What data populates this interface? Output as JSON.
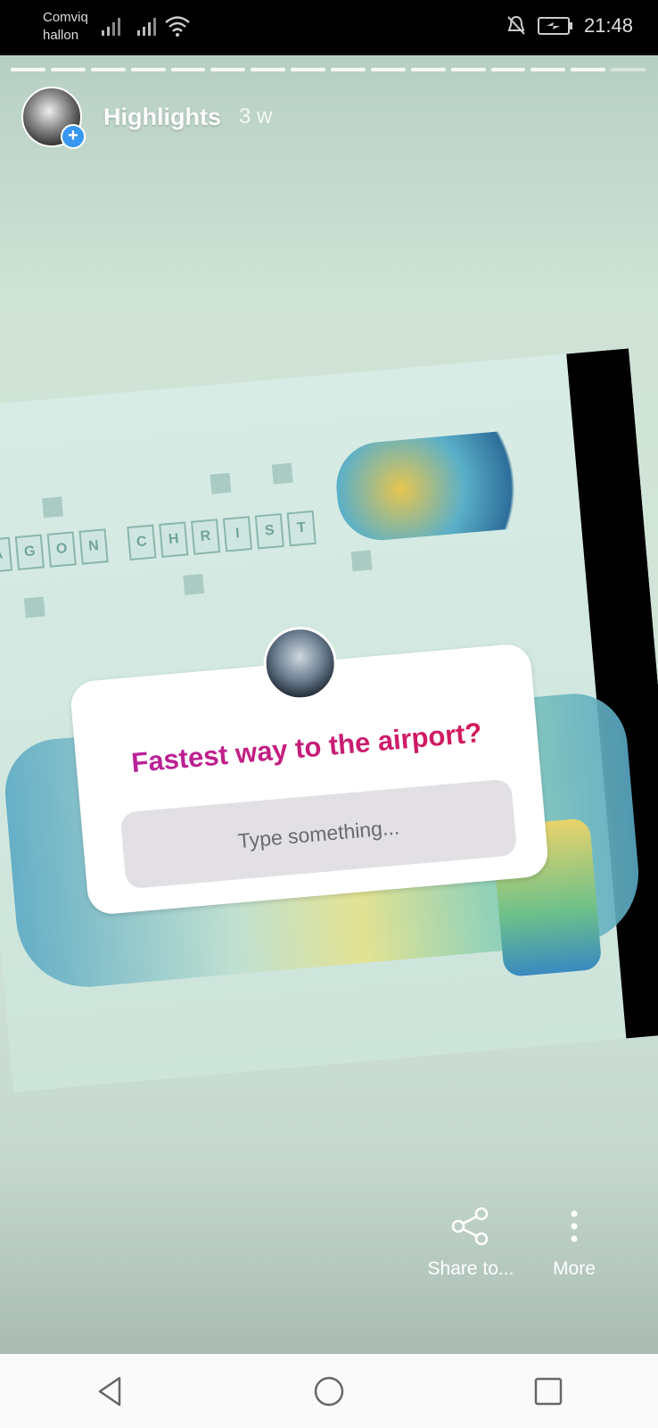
{
  "status_bar": {
    "carrier_line1": "Comviq",
    "carrier_line2": "hallon",
    "time": "21:48",
    "icons": [
      "signal-icon",
      "signal-icon",
      "wifi-icon",
      "mute-icon",
      "battery-icon"
    ]
  },
  "story": {
    "title": "Highlights",
    "age": "3 w",
    "progress_segments": 16,
    "progress_viewed": 15
  },
  "question_sticker": {
    "question": "Fastest way to the airport?",
    "placeholder": "Type something..."
  },
  "actions": {
    "share_label": "Share to...",
    "more_label": "More"
  },
  "colors": {
    "accent_blue": "#3897f0",
    "question_gradient_start": "#b423a6",
    "question_gradient_end": "#d8194f"
  }
}
